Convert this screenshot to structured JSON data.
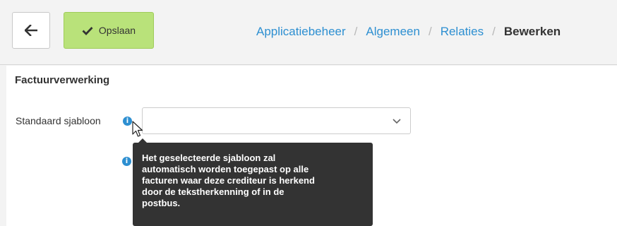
{
  "toolbar": {
    "back_icon": "arrow-left-icon",
    "save_icon": "checkmark-icon",
    "save_label": "Opslaan"
  },
  "breadcrumb": {
    "items": [
      "Applicatiebeheer",
      "Algemeen",
      "Relaties"
    ],
    "current": "Bewerken",
    "separator": "/"
  },
  "section": {
    "title": "Factuurverwerking"
  },
  "field": {
    "label": "Standaard sjabloon",
    "value": ""
  },
  "tooltip": {
    "text": "Het geselecteerde sjabloon zal\nautomatisch worden toegepast op alle\nfacturen waar deze crediteur is herkend\ndoor de tekstherkenning of in de\npostbus."
  },
  "colors": {
    "accent": "#2d8fd1",
    "save_button": "#b9e27a",
    "tooltip_bg": "#333333"
  }
}
